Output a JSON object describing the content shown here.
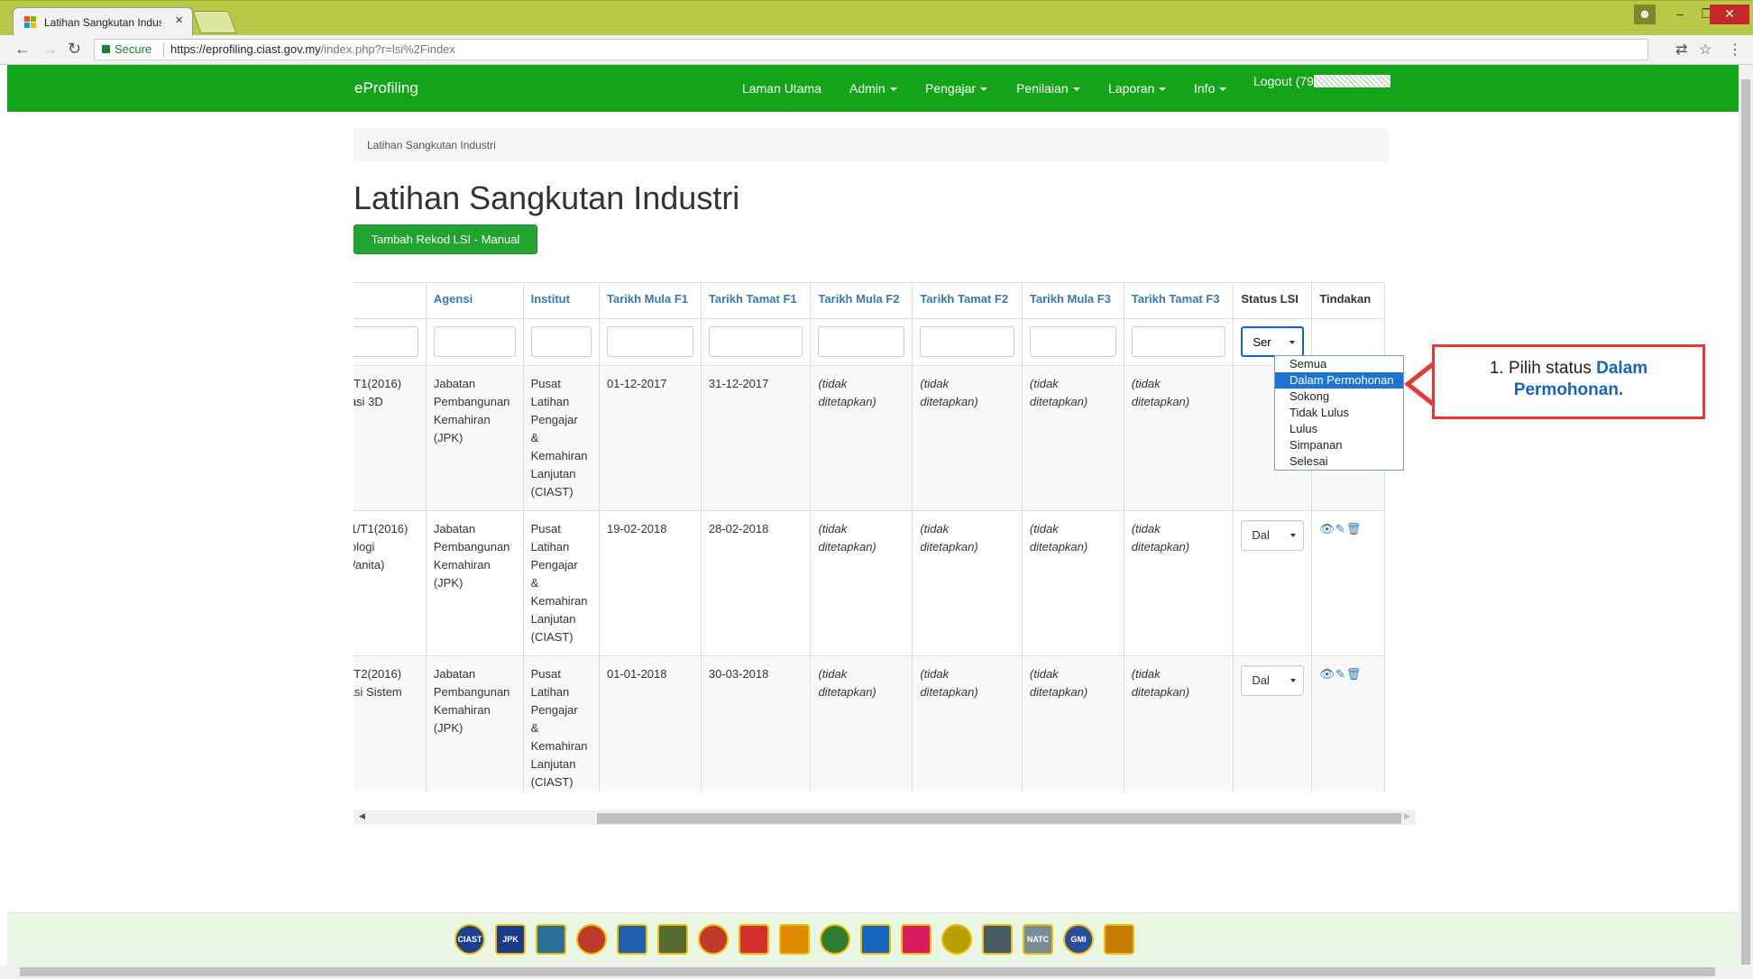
{
  "browser": {
    "tab_title": "Latihan Sangkutan Indus",
    "tab_close": "×",
    "secure_label": "Secure",
    "url_host": "https://eprofiling.ciast.gov.my",
    "url_rest": "/index.php?r=lsi%2Findex",
    "icons": [
      "back-icon",
      "forward-icon",
      "reload-icon",
      "lock-icon",
      "translate-icon",
      "star-icon",
      "menu-icon"
    ]
  },
  "navbar": {
    "brand": "eProfiling",
    "items": [
      "Laman Utama",
      "Admin",
      "Pengajar",
      "Penilaian",
      "Laporan",
      "Info"
    ],
    "logout": "Logout (79",
    "color": "#14a419"
  },
  "breadcrumb": "Latihan Sangkutan Industri",
  "page_title": "Latihan Sangkutan Industri",
  "add_button": "Tambah Rekod LSI - Manual",
  "table": {
    "headers": [
      "g",
      "Agensi",
      "Institut",
      "Tarikh Mula F1",
      "Tarikh Tamat F1",
      "Tarikh Mula F2",
      "Tarikh Tamat F2",
      "Tarikh Mula F3",
      "Tarikh Tamat F3",
      "Status LSI",
      "Tindakan"
    ],
    "filter_status": "Ser",
    "rows": [
      {
        "program": [
          "/2.1/T1(2016)",
          "nimasi 3D"
        ],
        "agensi": [
          "Jabatan",
          "Pembangunan",
          "Kemahiran",
          "(JPK)"
        ],
        "institut": [
          "Pusat",
          "Latihan",
          "Pengajar",
          "&",
          "Kemahiran",
          "Lanjutan",
          "(CIAST)"
        ],
        "mula_f1": "01-12-2017",
        "tamat_f1": "31-12-2017",
        "not_set": [
          "(tidak",
          "ditetapkan)"
        ],
        "status": ""
      },
      {
        "program": [
          "/17.1/T1(2016)",
          "eknologi",
          "n (Wanita)"
        ],
        "agensi": [
          "Jabatan",
          "Pembangunan",
          "Kemahiran",
          "(JPK)"
        ],
        "institut": [
          "Pusat",
          "Latihan",
          "Pengajar",
          "&",
          "Kemahiran",
          "Lanjutan",
          "(CIAST)"
        ],
        "mula_f1": "19-02-2018",
        "tamat_f1": "28-02-2018",
        "not_set": [
          "(tidak",
          "ditetapkan)"
        ],
        "status": "Dal"
      },
      {
        "program": [
          "/2.3/T2(2016)",
          "perasi Sistem",
          "uter"
        ],
        "agensi": [
          "Jabatan",
          "Pembangunan",
          "Kemahiran",
          "(JPK)"
        ],
        "institut": [
          "Pusat",
          "Latihan",
          "Pengajar",
          "&",
          "Kemahiran",
          "Lanjutan",
          "(CIAST)"
        ],
        "mula_f1": "01-01-2018",
        "tamat_f1": "30-03-2018",
        "not_set": [
          "(tidak",
          "ditetapkan)"
        ],
        "status": "Dal"
      }
    ]
  },
  "status_options": [
    "Semua",
    "Dalam Permohonan",
    "Sokong",
    "Tidak Lulus",
    "Lulus",
    "Simpanan",
    "Selesai"
  ],
  "status_selected_index": 1,
  "callout": {
    "text": "1. Pilih status ",
    "emphasis": "Dalam Permohonan."
  },
  "footer": {
    "logos": [
      "CIAST",
      "JPK",
      "ILJTM",
      "ADTEC",
      "IKBN",
      "IKTBN",
      "NIOSH",
      "LKIM",
      "CIDB",
      "MARA",
      "TEKUN",
      "SIRIM",
      "JKR",
      "PDRM",
      "NATC",
      "GMI",
      "SEAMEO"
    ],
    "logo_texts": [
      "CIAST",
      "JPK",
      "NATC",
      "GMI"
    ]
  }
}
